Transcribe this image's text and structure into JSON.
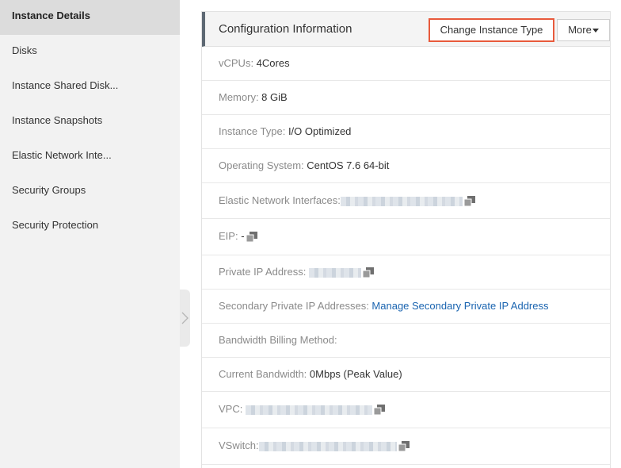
{
  "sidebar": {
    "items": [
      {
        "label": "Instance Details"
      },
      {
        "label": "Disks"
      },
      {
        "label": "Instance Shared Disk..."
      },
      {
        "label": "Instance Snapshots"
      },
      {
        "label": "Elastic Network Inte..."
      },
      {
        "label": "Security Groups"
      },
      {
        "label": "Security Protection"
      }
    ]
  },
  "panel": {
    "title": "Configuration Information",
    "change_button": "Change Instance Type",
    "more_button": "More"
  },
  "rows": {
    "vcpus": {
      "label": "vCPUs: ",
      "value": "4Cores"
    },
    "memory": {
      "label": "Memory: ",
      "value": "8 GiB"
    },
    "instance_type": {
      "label": "Instance Type: ",
      "value": "I/O Optimized"
    },
    "os": {
      "label": "Operating System: ",
      "value": "CentOS 7.6 64-bit"
    },
    "eni": {
      "label": "Elastic Network Interfaces:"
    },
    "eip": {
      "label": "EIP: ",
      "value": "-"
    },
    "private_ip": {
      "label": "Private IP Address: "
    },
    "secondary_ip": {
      "label": "Secondary Private IP Addresses: ",
      "link": "Manage Secondary Private IP Address"
    },
    "bandwidth_billing": {
      "label": "Bandwidth Billing Method:"
    },
    "current_bandwidth": {
      "label": "Current Bandwidth: ",
      "value": "0Mbps (Peak Value)"
    },
    "vpc": {
      "label": "VPC: "
    },
    "vswitch": {
      "label": "VSwitch:"
    }
  },
  "colors": {
    "highlight": "#e85a3c",
    "link": "#1a64b0",
    "sidebar_bg": "#f2f2f2",
    "sidebar_active": "#dcdcdc"
  }
}
